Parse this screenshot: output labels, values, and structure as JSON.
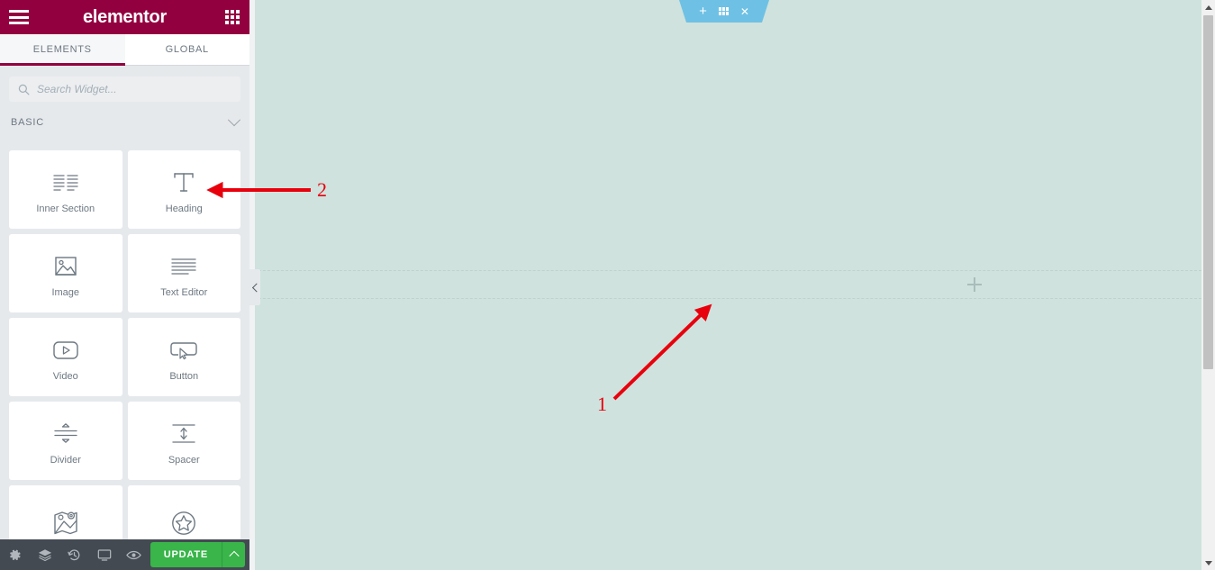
{
  "panel": {
    "brand": "elementor",
    "menu_icon": "hamburger-icon",
    "apps_icon": "grid-apps-icon",
    "tabs": [
      {
        "label": "ELEMENTS",
        "active": true
      },
      {
        "label": "GLOBAL",
        "active": false
      }
    ],
    "search": {
      "placeholder": "Search Widget...",
      "value": "",
      "icon": "search-icon"
    },
    "category": {
      "label": "BASIC",
      "chevron": "chevron-down-icon",
      "expanded": true
    },
    "widgets": [
      {
        "label": "Inner Section",
        "icon": "inner-section-icon"
      },
      {
        "label": "Heading",
        "icon": "heading-t-icon"
      },
      {
        "label": "Image",
        "icon": "image-icon"
      },
      {
        "label": "Text Editor",
        "icon": "text-editor-icon"
      },
      {
        "label": "Video",
        "icon": "video-play-icon"
      },
      {
        "label": "Button",
        "icon": "button-cursor-icon"
      },
      {
        "label": "Divider",
        "icon": "divider-icon"
      },
      {
        "label": "Spacer",
        "icon": "spacer-icon"
      },
      {
        "label": "",
        "icon": "google-maps-icon"
      },
      {
        "label": "",
        "icon": "star-rating-icon"
      }
    ],
    "footer": {
      "icons": [
        "settings-gear-icon",
        "navigator-layers-icon",
        "history-revisions-icon",
        "responsive-mode-icon",
        "preview-eye-icon"
      ],
      "update_label": "UPDATE",
      "update_caret": "caret-up-icon",
      "update_color": "#39b54a"
    },
    "collapse_handle": "chevron-left-icon"
  },
  "canvas": {
    "background_color": "#cfe2dd",
    "section_toolbar": {
      "color": "#6ec1e4",
      "buttons": [
        {
          "icon": "plus-icon",
          "glyph": "+"
        },
        {
          "icon": "drag-handle-grid-icon",
          "glyph": ""
        },
        {
          "icon": "close-x-icon",
          "glyph": "✕"
        }
      ]
    },
    "add_element_button": "plus-add-element-icon"
  },
  "annotations": [
    {
      "label": "1",
      "color": "#e8000d",
      "points_to": "add-element-plus-button"
    },
    {
      "label": "2",
      "color": "#e8000d",
      "points_to": "widget-heading"
    }
  ],
  "scrollbar": {
    "up_arrow": "scroll-up-arrow-icon",
    "down_arrow": "scroll-down-arrow-icon"
  }
}
